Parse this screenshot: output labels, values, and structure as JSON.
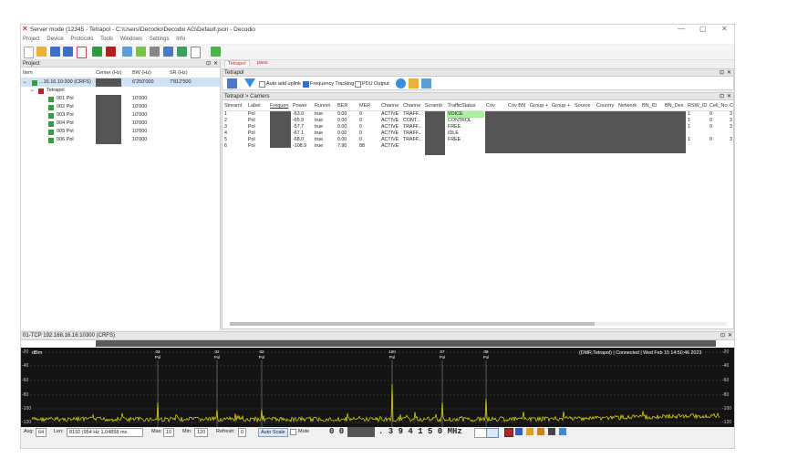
{
  "window": {
    "title": "Server mode (12345 - Tetrapol - C:\\Users\\Decodio\\Decodio AG\\Default.json - Decodio",
    "minimize": "—",
    "maximize": "▢",
    "close": "✕"
  },
  "menu": [
    "Project",
    "Device",
    "Protocols",
    "Tools",
    "Windows",
    "Settings",
    "Info"
  ],
  "project_panel": {
    "title": "Project",
    "columns": [
      "Item",
      "Center (Hz)",
      "BW (Hz)",
      "SR (Hz)"
    ],
    "device": {
      "name": "...16.16.10:300 (CRFS)",
      "center": "",
      "bw": "6'250'000",
      "sr": "7'812'500"
    },
    "protocol": {
      "name": "Tetrapol"
    },
    "items": [
      {
        "name": "001 Pol",
        "bw": "10'000"
      },
      {
        "name": "002 Pol",
        "bw": "10'000"
      },
      {
        "name": "003 Pol",
        "bw": "10'000"
      },
      {
        "name": "004 Pol",
        "bw": "10'000"
      },
      {
        "name": "005 Pol",
        "bw": "10'000"
      },
      {
        "name": "006 Pol",
        "bw": "10'000"
      }
    ]
  },
  "tabs": [
    {
      "label": "Tetrapol"
    },
    {
      "label": "pass"
    }
  ],
  "tetrapol_panel": {
    "title": "Tetrapol",
    "auto_add_uplink": "Auto add uplink",
    "frequency_tracking": "Frequency Tracking",
    "pdu_output": "PDU Output",
    "auto_add_checked": false,
    "freq_tracking_checked": true,
    "pdu_checked": false
  },
  "carriers": {
    "title": "Tetrapol > Carriers",
    "columns": [
      "StreamI",
      "Label",
      "Frequen",
      "Power",
      "Runnin",
      "BER",
      "MER",
      "Channe",
      "Channe",
      "Scramb",
      "TrafficStatus",
      "Cov",
      "Cov BN",
      "Group +",
      "Group +",
      "Source",
      "Country",
      "Network",
      "BN_ID",
      "BN_Des",
      "RSW_ID",
      "Cell_No",
      "C"
    ],
    "rows": [
      {
        "stream": "1",
        "label": "Pol",
        "power": "-63.0",
        "running": "true",
        "ber": "0.00",
        "mer": "0",
        "ch1": "ACTIVE",
        "ch2": "TRAFF...",
        "traffic": "VOICE",
        "rsw": "1",
        "cell": "0",
        "c": "3"
      },
      {
        "stream": "2",
        "label": "Pol",
        "power": "-65.9",
        "running": "true",
        "ber": "0.00",
        "mer": "0",
        "ch1": "ACTIVE",
        "ch2": "CONT...",
        "traffic": "CONTROL",
        "rsw": "1",
        "cell": "0",
        "c": "3"
      },
      {
        "stream": "3",
        "label": "Pol",
        "power": "-57.7",
        "running": "true",
        "ber": "0.00",
        "mer": "0",
        "ch1": "ACTIVE",
        "ch2": "TRAFF...",
        "traffic": "FREE",
        "rsw": "1",
        "cell": "0",
        "c": "3"
      },
      {
        "stream": "4",
        "label": "Pol",
        "power": "-67.1",
        "running": "true",
        "ber": "0.00",
        "mer": "0",
        "ch1": "ACTIVE",
        "ch2": "TRAFF...",
        "traffic": "IDLE",
        "rsw": "",
        "cell": "",
        "c": ""
      },
      {
        "stream": "5",
        "label": "Pol",
        "power": "-68.0",
        "running": "true",
        "ber": "0.00",
        "mer": "0",
        "ch1": "ACTIVE",
        "ch2": "TRAFF...",
        "traffic": "FREE",
        "rsw": "1",
        "cell": "0",
        "c": "3"
      },
      {
        "stream": "6",
        "label": "Pol",
        "power": "-108.9",
        "running": "true",
        "ber": "7.90",
        "mer": "88",
        "ch1": "ACTIVE",
        "ch2": "",
        "traffic": "",
        "rsw": "",
        "cell": "",
        "c": ""
      }
    ]
  },
  "spectrum": {
    "title": "01-TCP 192.168.16.16:10300 (CRFS)",
    "unit": "dBm",
    "status": "(DMR,Tetrapol) | Connected | Wed Feb 15 14:50:46 2023",
    "left_ticks": [
      "-20",
      "-40",
      "-60",
      "-80",
      "-100",
      "-120"
    ],
    "right_ticks": [
      "-20",
      "-40",
      "-60",
      "-80",
      "-100",
      "-120"
    ],
    "markers": [
      {
        "num": "03",
        "label": "Pol"
      },
      {
        "num": "02",
        "label": "Pol"
      },
      {
        "num": "02",
        "label": "Pol"
      },
      {
        "num": "100",
        "label": "Pol"
      },
      {
        "num": "07",
        "label": "Pol"
      },
      {
        "num": "09",
        "label": "Pol"
      }
    ]
  },
  "bottom": {
    "avg_label": "Avg:",
    "avg_value": "64",
    "len_label": "Len:",
    "len_value": "8192 (954 Hz 1.04858 ms",
    "max_label": "Max:",
    "max_value": "10",
    "min_label": "Min:",
    "min_value": "120",
    "refresh_label": "Refresh:",
    "refresh_value": "0",
    "autoscale_label": "Auto Scale",
    "mute_label": "Mute",
    "freq_prefix": "0 0",
    "freq_suffix": ". 3 9 4 1 5 0 MHz"
  },
  "colors": {
    "accent": "#2a6fdb",
    "spectrum_bg": "#141414",
    "trace": "#e8e200",
    "voice_bg": "#a8f0a0"
  }
}
